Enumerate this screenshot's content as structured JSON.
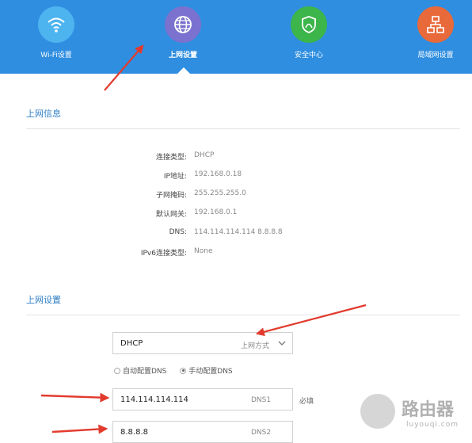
{
  "nav": {
    "items": [
      {
        "label": "Wi-Fi设置",
        "icon": "wifi-icon",
        "color": "#4db4f0"
      },
      {
        "label": "上网设置",
        "icon": "globe-icon",
        "color": "#7b72cf",
        "active": true
      },
      {
        "label": "安全中心",
        "icon": "shield-icon",
        "color": "#3cb54a"
      },
      {
        "label": "局域网设置",
        "icon": "network-icon",
        "color": "#e8693a"
      }
    ],
    "background": "#2f8ee0"
  },
  "info": {
    "title": "上网信息",
    "rows": [
      {
        "label": "连接类型:",
        "value": "DHCP"
      },
      {
        "label": "IP地址:",
        "value": "192.168.0.18"
      },
      {
        "label": "子网掩码:",
        "value": "255.255.255.0"
      },
      {
        "label": "默认网关:",
        "value": "192.168.0.1"
      },
      {
        "label": "DNS:",
        "value": "114.114.114.114 8.8.8.8"
      },
      {
        "label": "IPv6连接类型:",
        "value": "None"
      }
    ]
  },
  "settings": {
    "title": "上网设置",
    "mode": {
      "value": "DHCP",
      "hint": "上网方式"
    },
    "dns_options": [
      {
        "label": "自动配置DNS",
        "checked": false
      },
      {
        "label": "手动配置DNS",
        "checked": true
      }
    ],
    "dns1": {
      "value": "114.114.114.114",
      "tag": "DNS1",
      "required": "必填"
    },
    "dns2": {
      "value": "8.8.8.8",
      "tag": "DNS2"
    }
  },
  "watermark": {
    "text": "路由器",
    "sub": "luyouqi.com"
  }
}
